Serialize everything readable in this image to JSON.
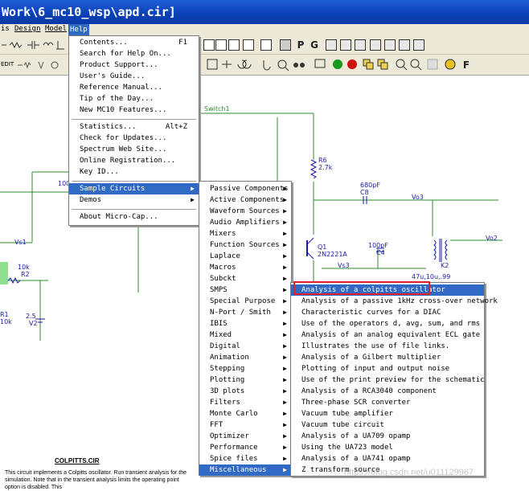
{
  "window": {
    "title": "Work\\6_mc10_wsp\\apd.cir]"
  },
  "menubar": {
    "items": [
      {
        "label": "is"
      },
      {
        "label": "Design"
      },
      {
        "label": "Model"
      },
      {
        "label": "Help"
      }
    ]
  },
  "help_menu": {
    "items": [
      {
        "label": "Contents...",
        "shortcut": "F1"
      },
      {
        "label": "Search for Help On..."
      },
      {
        "label": "Product Support..."
      },
      {
        "label": "User's Guide..."
      },
      {
        "label": "Reference Manual..."
      },
      {
        "label": "Tip of the Day..."
      },
      {
        "label": "New MC10 Features..."
      },
      {
        "label": "Statistics...",
        "shortcut": "Alt+Z"
      },
      {
        "label": "Check for Updates..."
      },
      {
        "label": "Spectrum Web Site..."
      },
      {
        "label": "Online Registration..."
      },
      {
        "label": "Key ID..."
      },
      {
        "label": "Sample Circuits"
      },
      {
        "label": "Demos"
      },
      {
        "label": "About Micro-Cap..."
      }
    ]
  },
  "sample_circuits_menu": {
    "items": [
      {
        "label": "Passive Components"
      },
      {
        "label": "Active Components"
      },
      {
        "label": "Waveform Sources"
      },
      {
        "label": "Audio Amplifiers"
      },
      {
        "label": "Mixers"
      },
      {
        "label": "Function Sources"
      },
      {
        "label": "Laplace"
      },
      {
        "label": "Macros"
      },
      {
        "label": "Subckt"
      },
      {
        "label": "SMPS"
      },
      {
        "label": "Special Purpose"
      },
      {
        "label": "N-Port / Smith"
      },
      {
        "label": "IBIS"
      },
      {
        "label": "Mixed"
      },
      {
        "label": "Digital"
      },
      {
        "label": "Animation"
      },
      {
        "label": "Stepping"
      },
      {
        "label": "Plotting"
      },
      {
        "label": "3D plots"
      },
      {
        "label": "Filters"
      },
      {
        "label": "Monte Carlo"
      },
      {
        "label": "FFT"
      },
      {
        "label": "Optimizer"
      },
      {
        "label": "Performance"
      },
      {
        "label": "Spice files"
      },
      {
        "label": "Miscellaneous"
      }
    ]
  },
  "misc_menu": {
    "items": [
      {
        "label": "Analysis of a colpitts oscillator"
      },
      {
        "label": "Analysis of a passive 1kHz cross-over network"
      },
      {
        "label": "Characteristic curves for a DIAC"
      },
      {
        "label": "Use of the operators d, avg, sum, and rms"
      },
      {
        "label": "Analysis of an analog equivalent ECL gate"
      },
      {
        "label": "Illustrates the use of file links."
      },
      {
        "label": "Analysis of a Gilbert multiplier"
      },
      {
        "label": "Plotting of input and output noise"
      },
      {
        "label": "Use of the print preview for the schematic"
      },
      {
        "label": "Analysis of a RCA3040 component"
      },
      {
        "label": "Three-phase SCR converter"
      },
      {
        "label": "Vacuum tube amplifier"
      },
      {
        "label": "Vacuum tube circuit"
      },
      {
        "label": "Analysis of a UA709 opamp"
      },
      {
        "label": "Using the UA723 model"
      },
      {
        "label": "Analysis of a UA741 opamp"
      },
      {
        "label": "Z transform source"
      }
    ]
  },
  "toolbar": {
    "text_buttons": [
      "P",
      "G",
      "F"
    ],
    "edit_label": "EDIT"
  },
  "schematic": {
    "labels": {
      "switch": "Switch1",
      "r6": "R6",
      "r6_val": "2.7k",
      "c8_val": "680pF",
      "c8": "C8",
      "vo3": "Vo3",
      "q1": "Q1",
      "q1_model": "2N2221A",
      "c4_val": "100pF",
      "c4": "C4",
      "vo2": "Vo2",
      "vs3": "Vs3",
      "k2": "K2",
      "k2_val": "47u,10u,.99",
      "vs1": "Vs1",
      "r_10k": "10k",
      "r2": "R2",
      "r1": "R1",
      "r1_val": "10k",
      "v2_val": "2.5",
      "v2": "V2",
      "partial_100": "100"
    },
    "doc": {
      "title": "COLPITTS.CIR",
      "text": "This circuit implements a Colpitts oscillator. Run transient analysis for the simulation. Note that in the transient analysis limits the operating point option is disabled. This"
    }
  },
  "watermark": "https://blog.csdn.net/u011129967",
  "colors": {
    "titlebar": "#0a3fb5",
    "menu_highlight": "#316ac5",
    "wire": "#2e8b2e",
    "label": "#1a1aa8",
    "focus_box": "#e0202a"
  }
}
